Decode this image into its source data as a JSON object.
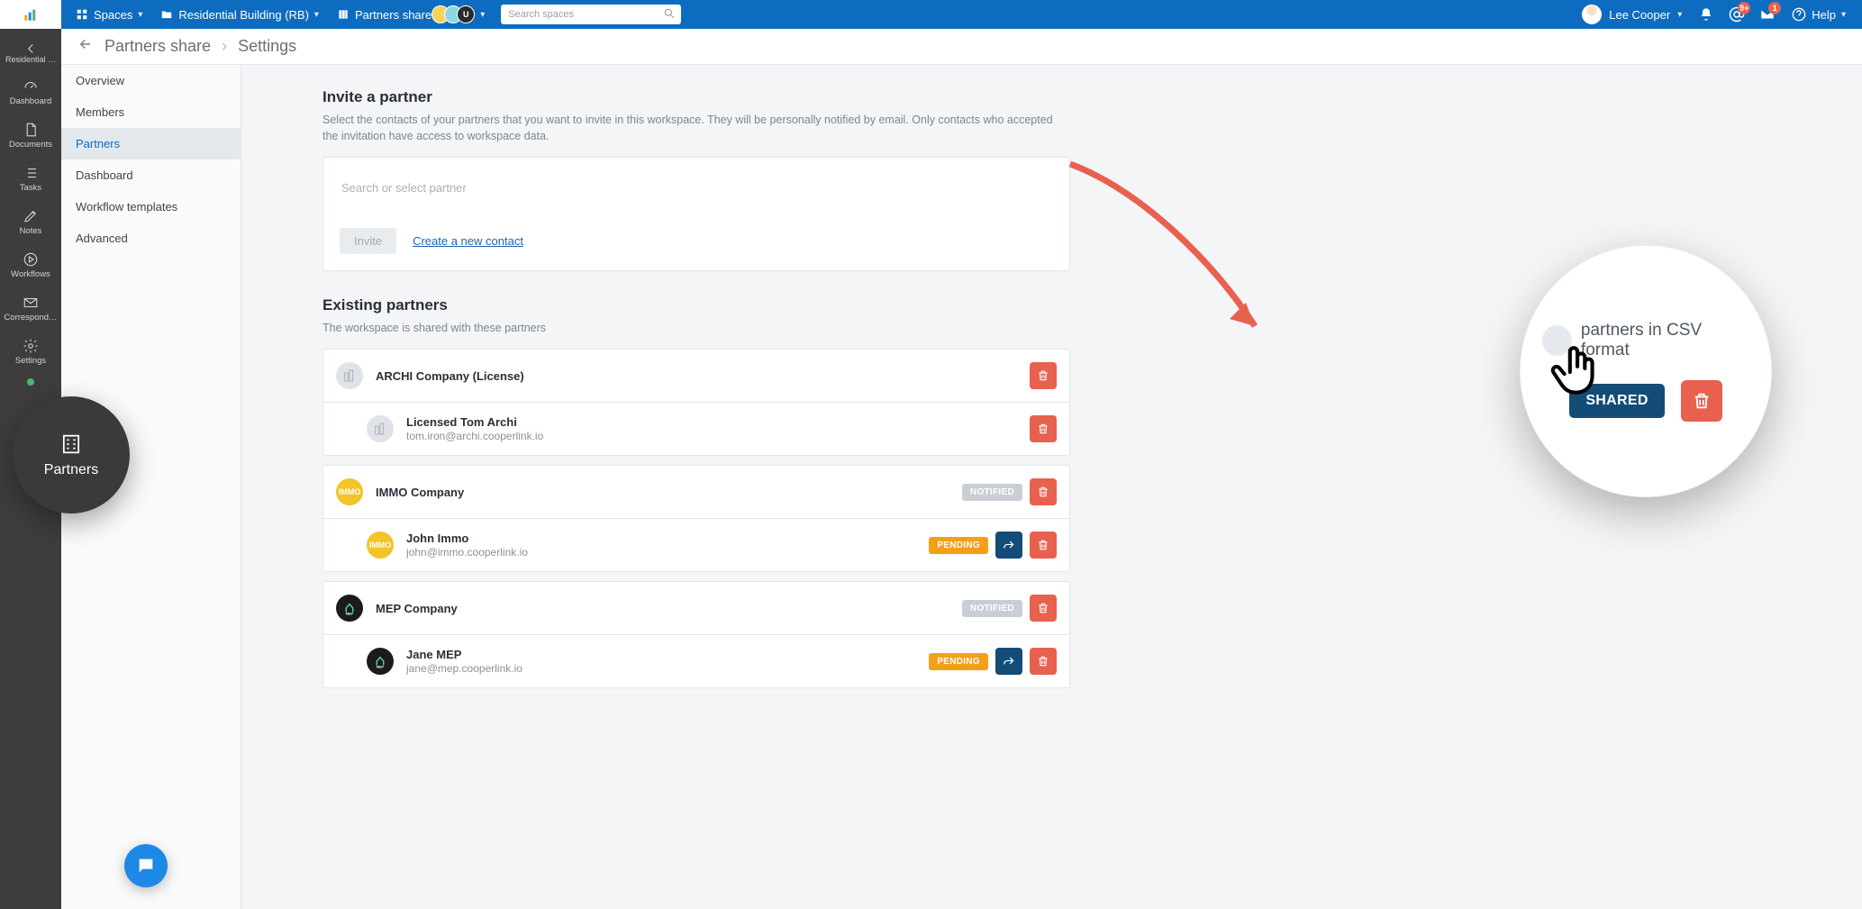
{
  "topbar": {
    "spaces_label": "Spaces",
    "project_label": "Residential Building (RB)",
    "share_label": "Partners share",
    "search_placeholder": "Search spaces",
    "user_name": "Lee Cooper",
    "help_label": "Help",
    "badge_at": "9+",
    "badge_inbox": "1"
  },
  "rail": {
    "back_label": "Residential …",
    "items": [
      {
        "label": "Dashboard",
        "icon": "gauge"
      },
      {
        "label": "Documents",
        "icon": "doc"
      },
      {
        "label": "Tasks",
        "icon": "list"
      },
      {
        "label": "Notes",
        "icon": "pencil"
      },
      {
        "label": "Workflows",
        "icon": "play-circle"
      },
      {
        "label": "Correspond…",
        "icon": "mail"
      },
      {
        "label": "Settings",
        "icon": "gear"
      }
    ]
  },
  "float_partners_label": "Partners",
  "settings_nav": {
    "items": [
      "Overview",
      "Members",
      "Partners",
      "Dashboard",
      "Workflow templates",
      "Advanced"
    ],
    "active_index": 2
  },
  "crumbs": {
    "node1": "Partners share",
    "node2": "Settings"
  },
  "invite": {
    "title": "Invite a partner",
    "desc": "Select the contacts of your partners that you want to invite in this workspace. They will be personally notified by email. Only contacts who accepted the invitation have access to workspace data.",
    "search_placeholder": "Search or select partner",
    "invite_btn": "Invite",
    "create_link": "Create a new contact"
  },
  "existing": {
    "title": "Existing partners",
    "desc": "The workspace is shared with these partners",
    "companies": [
      {
        "logo": "archi",
        "name": "ARCHI Company (License)",
        "status": null,
        "contacts": [
          {
            "logo": "archi",
            "name": "Licensed Tom Archi",
            "email": "tom.iron@archi.cooperlink.io",
            "status": null
          }
        ]
      },
      {
        "logo": "immo",
        "short": "IMMO",
        "name": "IMMO Company",
        "status": "NOTIFIED",
        "contacts": [
          {
            "logo": "immo",
            "short": "IMMO",
            "name": "John Immo",
            "email": "john@immo.cooperlink.io",
            "status": "PENDING"
          }
        ]
      },
      {
        "logo": "mep",
        "short": "MEP",
        "name": "MEP Company",
        "status": "NOTIFIED",
        "contacts": [
          {
            "logo": "mep",
            "short": "MEP",
            "name": "Jane MEP",
            "email": "jane@mep.cooperlink.io",
            "status": "PENDING"
          }
        ]
      }
    ]
  },
  "magnifier": {
    "csv_label": "partners in CSV format",
    "shared_label": "SHARED"
  }
}
